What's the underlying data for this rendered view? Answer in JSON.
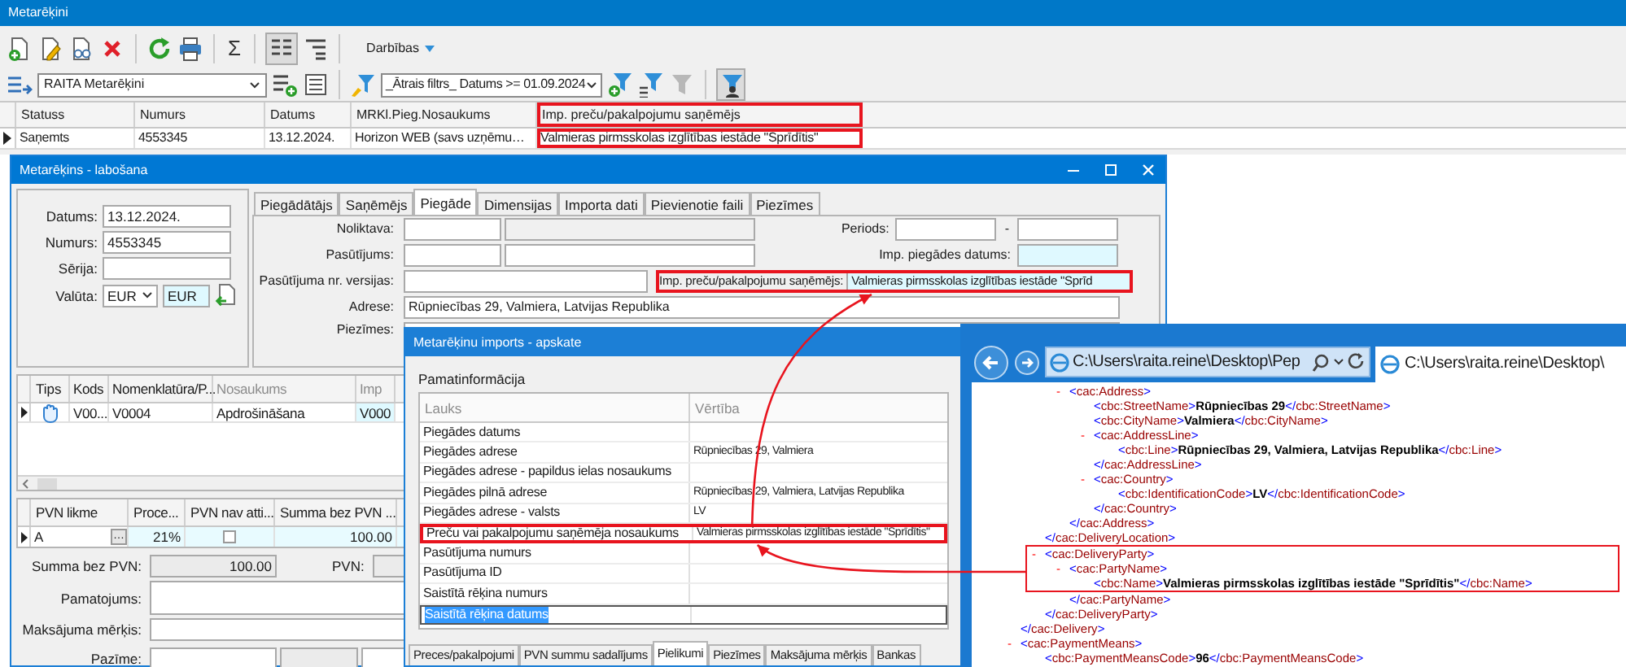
{
  "main_window": {
    "title": "Metarēķini",
    "sum_symbol": "Σ",
    "actions_menu": "Darbības",
    "view_select": "RAITA Metarēķini",
    "filter_select": "_Ātrais filtrs_ Datums >= 01.09.2024",
    "table": {
      "columns": [
        {
          "label": "Statuss",
          "highlighted": false
        },
        {
          "label": "Numurs",
          "highlighted": false
        },
        {
          "label": "Datums",
          "highlighted": false
        },
        {
          "label": "MRKl.Pieg.Nosaukums",
          "highlighted": false
        },
        {
          "label": "Imp. preču/pakalpojumu saņēmējs",
          "highlighted": true
        }
      ],
      "rows": [
        {
          "selected": true,
          "cells": [
            "Saņemts",
            "4553345",
            "13.12.2024.",
            "Horizon WEB (savs uzņēmu…",
            "Valmieras pirmsskolas izglītības iestāde \"Sprīdītis\""
          ]
        }
      ]
    }
  },
  "edit_window": {
    "title": "Metarēķins - labošana",
    "header_fields": [
      {
        "label": "Datums:",
        "value": "13.12.2024."
      },
      {
        "label": "Numurs:",
        "value": "4553345"
      },
      {
        "label": "Sērija:"
      }
    ],
    "currency": {
      "label": "Valūta:",
      "code": "EUR",
      "value": "EUR"
    },
    "tabs": [
      {
        "label": "Piegādātājs",
        "selected": false
      },
      {
        "label": "Saņēmējs",
        "selected": false
      },
      {
        "label": "Piegāde",
        "selected": true
      },
      {
        "label": "Dimensijas",
        "selected": false
      },
      {
        "label": "Importa dati",
        "selected": false
      },
      {
        "label": "Pievienotie faili",
        "selected": false
      },
      {
        "label": "Piezīmes",
        "selected": false
      }
    ],
    "delivery": {
      "warehouse": {
        "label": "Noliktava:"
      },
      "order": {
        "label": "Pasūtījums:"
      },
      "order_version": {
        "label": "Pasūtījuma nr. versijas:"
      },
      "period": {
        "label": "Periods:",
        "separator": "-"
      },
      "imp_date": {
        "label": "Imp. piegādes datums:"
      },
      "imp_recipient": {
        "label": "Imp. preču/pakalpojumu saņēmējs:",
        "value": "Valmieras pirmsskolas izglītības iestāde \"Sprīd",
        "highlighted": true
      },
      "address": {
        "label": "Adrese:",
        "value": "Rūpniecības 29, Valmiera, Latvijas Republika"
      },
      "notes": {
        "label": "Piezīmes:"
      }
    },
    "items_table": {
      "icon_column": "Tips",
      "columns": [
        "Kods",
        "Nomenklatūra/P...",
        "Nosaukums",
        "Imp"
      ],
      "rows": [
        {
          "selected": true,
          "cells": [
            "V00...",
            "V0004",
            "Apdrošināšana",
            "V000"
          ]
        }
      ]
    },
    "vat_table": {
      "columns": [
        "PVN likme",
        "Proce...",
        "PVN nav atti...",
        "Summa bez PVN ..."
      ],
      "rows": [
        {
          "selected": true,
          "rate": "A",
          "picker": "…",
          "percent": "21%",
          "not_applicable": false,
          "sum": "100.00"
        }
      ]
    },
    "totals": {
      "sum": {
        "label": "Summa bez PVN:",
        "value": "100.00"
      },
      "vat": {
        "label": "PVN:"
      },
      "reason": {
        "label": "Pamatojums:"
      },
      "purpose": {
        "label": "Maksājuma mērķis:"
      },
      "mark": {
        "label": "Pazīme:"
      }
    }
  },
  "import_window": {
    "title": "Metarēķinu imports - apskate",
    "section": "Pamatinformācija",
    "columns": [
      "Lauks",
      "Vērtība"
    ],
    "rows": [
      {
        "field": "Piegādes datums",
        "selected": false,
        "highlighted": false
      },
      {
        "field": "Piegādes adrese",
        "value": "Rūpniecības 29, Valmiera",
        "selected": false,
        "highlighted": false
      },
      {
        "field": "Piegādes adrese - papildus ielas nosaukums",
        "selected": false,
        "highlighted": false
      },
      {
        "field": "Piegādes pilnā adrese",
        "value": "Rūpniecības 29, Valmiera, Latvijas Republika",
        "selected": false,
        "highlighted": false
      },
      {
        "field": "Piegādes adrese - valsts",
        "value": "LV",
        "selected": false,
        "highlighted": false
      },
      {
        "field": "Preču vai pakalpojumu saņēmēja nosaukums",
        "value": "Valmieras pirmsskolas izglītības iestāde \"Sprīdītis\"",
        "selected": false,
        "highlighted": true
      },
      {
        "field": "Pasūtījuma numurs",
        "selected": false,
        "highlighted": false
      },
      {
        "field": "Pasūtījuma ID",
        "selected": false,
        "highlighted": false
      },
      {
        "field": "Saistītā rēķina numurs",
        "selected": false,
        "highlighted": false
      },
      {
        "field": "Saistītā rēķina datums",
        "selected": true,
        "highlighted": false
      }
    ],
    "tabs": [
      {
        "label": "Preces/pakalpojumi",
        "selected": false
      },
      {
        "label": "PVN summu sadalījums",
        "selected": false
      },
      {
        "label": "Pielikumi",
        "selected": true
      },
      {
        "label": "Piezīmes",
        "selected": false
      },
      {
        "label": "Maksājuma mērķis",
        "selected": false
      },
      {
        "label": "Bankas",
        "selected": false
      }
    ]
  },
  "browser": {
    "address": "C:\\Users\\raita.reine\\Desktop\\Pep",
    "tab_title": "C:\\Users\\raita.reine\\Desktop\\",
    "xml": [
      {
        "close": "</cac:Delivery>",
        "highlighted": false,
        "children": [
          {
            "close": "</cac:DeliveryLocation>",
            "highlighted": false,
            "children": [
              {
                "toggle": "-",
                "open": "<cac:Address>",
                "close": "</cac:Address>",
                "highlighted": false,
                "children": [
                  {
                    "open": "<cbc:StreetName>",
                    "value": "Rūpniecības 29",
                    "close": "</cbc:StreetName>",
                    "highlighted": false
                  },
                  {
                    "open": "<cbc:CityName>",
                    "value": "Valmiera",
                    "close": "</cbc:CityName>",
                    "highlighted": false
                  },
                  {
                    "toggle": "-",
                    "open": "<cac:AddressLine>",
                    "close": "</cac:AddressLine>",
                    "highlighted": false,
                    "children": [
                      {
                        "open": "<cbc:Line>",
                        "value": "Rūpniecības 29, Valmiera, Latvijas Republika",
                        "close": "</cbc:Line>",
                        "highlighted": false
                      }
                    ]
                  },
                  {
                    "toggle": "-",
                    "open": "<cac:Country>",
                    "close": "</cac:Country>",
                    "highlighted": false,
                    "children": [
                      {
                        "open": "<cbc:IdentificationCode>",
                        "value": "LV",
                        "close": "</cbc:IdentificationCode>",
                        "highlighted": false
                      }
                    ]
                  }
                ]
              }
            ]
          },
          {
            "toggle": "-",
            "open": "<cac:DeliveryParty>",
            "close": "</cac:DeliveryParty>",
            "highlighted": true,
            "children": [
              {
                "toggle": "-",
                "open": "<cac:PartyName>",
                "close": "</cac:PartyName>",
                "highlighted": true,
                "children": [
                  {
                    "open": "<cbc:Name>",
                    "value": "Valmieras pirmsskolas izglītības iestāde \"Sprīdītis\"",
                    "close": "</cbc:Name>",
                    "highlighted": true
                  }
                ]
              }
            ]
          }
        ]
      },
      {
        "toggle": "-",
        "open": "<cac:PaymentMeans>",
        "highlighted": false,
        "children": [
          {
            "open": "<cbc:PaymentMeansCode>",
            "value": "96",
            "close": "</cbc:PaymentMeansCode>",
            "highlighted": false
          }
        ]
      }
    ]
  }
}
